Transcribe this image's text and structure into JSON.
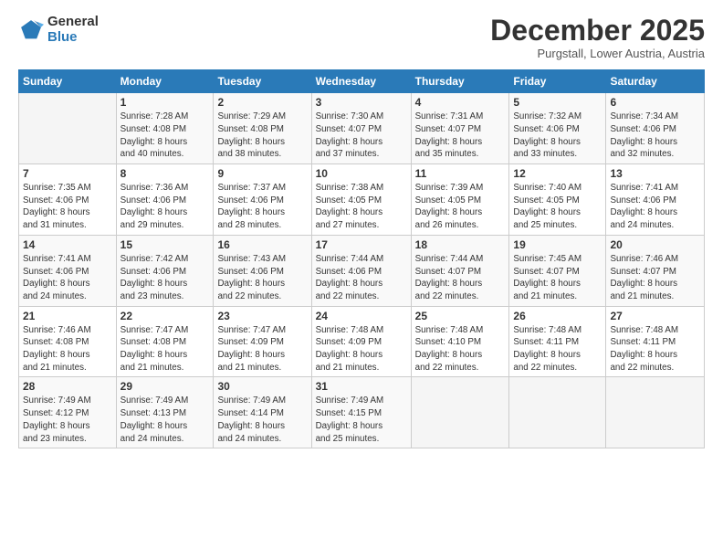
{
  "logo": {
    "general": "General",
    "blue": "Blue"
  },
  "header": {
    "month": "December 2025",
    "location": "Purgstall, Lower Austria, Austria"
  },
  "weekdays": [
    "Sunday",
    "Monday",
    "Tuesday",
    "Wednesday",
    "Thursday",
    "Friday",
    "Saturday"
  ],
  "weeks": [
    [
      {
        "day": "",
        "info": ""
      },
      {
        "day": "1",
        "info": "Sunrise: 7:28 AM\nSunset: 4:08 PM\nDaylight: 8 hours\nand 40 minutes."
      },
      {
        "day": "2",
        "info": "Sunrise: 7:29 AM\nSunset: 4:08 PM\nDaylight: 8 hours\nand 38 minutes."
      },
      {
        "day": "3",
        "info": "Sunrise: 7:30 AM\nSunset: 4:07 PM\nDaylight: 8 hours\nand 37 minutes."
      },
      {
        "day": "4",
        "info": "Sunrise: 7:31 AM\nSunset: 4:07 PM\nDaylight: 8 hours\nand 35 minutes."
      },
      {
        "day": "5",
        "info": "Sunrise: 7:32 AM\nSunset: 4:06 PM\nDaylight: 8 hours\nand 33 minutes."
      },
      {
        "day": "6",
        "info": "Sunrise: 7:34 AM\nSunset: 4:06 PM\nDaylight: 8 hours\nand 32 minutes."
      }
    ],
    [
      {
        "day": "7",
        "info": "Sunrise: 7:35 AM\nSunset: 4:06 PM\nDaylight: 8 hours\nand 31 minutes."
      },
      {
        "day": "8",
        "info": "Sunrise: 7:36 AM\nSunset: 4:06 PM\nDaylight: 8 hours\nand 29 minutes."
      },
      {
        "day": "9",
        "info": "Sunrise: 7:37 AM\nSunset: 4:06 PM\nDaylight: 8 hours\nand 28 minutes."
      },
      {
        "day": "10",
        "info": "Sunrise: 7:38 AM\nSunset: 4:05 PM\nDaylight: 8 hours\nand 27 minutes."
      },
      {
        "day": "11",
        "info": "Sunrise: 7:39 AM\nSunset: 4:05 PM\nDaylight: 8 hours\nand 26 minutes."
      },
      {
        "day": "12",
        "info": "Sunrise: 7:40 AM\nSunset: 4:05 PM\nDaylight: 8 hours\nand 25 minutes."
      },
      {
        "day": "13",
        "info": "Sunrise: 7:41 AM\nSunset: 4:06 PM\nDaylight: 8 hours\nand 24 minutes."
      }
    ],
    [
      {
        "day": "14",
        "info": "Sunrise: 7:41 AM\nSunset: 4:06 PM\nDaylight: 8 hours\nand 24 minutes."
      },
      {
        "day": "15",
        "info": "Sunrise: 7:42 AM\nSunset: 4:06 PM\nDaylight: 8 hours\nand 23 minutes."
      },
      {
        "day": "16",
        "info": "Sunrise: 7:43 AM\nSunset: 4:06 PM\nDaylight: 8 hours\nand 22 minutes."
      },
      {
        "day": "17",
        "info": "Sunrise: 7:44 AM\nSunset: 4:06 PM\nDaylight: 8 hours\nand 22 minutes."
      },
      {
        "day": "18",
        "info": "Sunrise: 7:44 AM\nSunset: 4:07 PM\nDaylight: 8 hours\nand 22 minutes."
      },
      {
        "day": "19",
        "info": "Sunrise: 7:45 AM\nSunset: 4:07 PM\nDaylight: 8 hours\nand 21 minutes."
      },
      {
        "day": "20",
        "info": "Sunrise: 7:46 AM\nSunset: 4:07 PM\nDaylight: 8 hours\nand 21 minutes."
      }
    ],
    [
      {
        "day": "21",
        "info": "Sunrise: 7:46 AM\nSunset: 4:08 PM\nDaylight: 8 hours\nand 21 minutes."
      },
      {
        "day": "22",
        "info": "Sunrise: 7:47 AM\nSunset: 4:08 PM\nDaylight: 8 hours\nand 21 minutes."
      },
      {
        "day": "23",
        "info": "Sunrise: 7:47 AM\nSunset: 4:09 PM\nDaylight: 8 hours\nand 21 minutes."
      },
      {
        "day": "24",
        "info": "Sunrise: 7:48 AM\nSunset: 4:09 PM\nDaylight: 8 hours\nand 21 minutes."
      },
      {
        "day": "25",
        "info": "Sunrise: 7:48 AM\nSunset: 4:10 PM\nDaylight: 8 hours\nand 22 minutes."
      },
      {
        "day": "26",
        "info": "Sunrise: 7:48 AM\nSunset: 4:11 PM\nDaylight: 8 hours\nand 22 minutes."
      },
      {
        "day": "27",
        "info": "Sunrise: 7:48 AM\nSunset: 4:11 PM\nDaylight: 8 hours\nand 22 minutes."
      }
    ],
    [
      {
        "day": "28",
        "info": "Sunrise: 7:49 AM\nSunset: 4:12 PM\nDaylight: 8 hours\nand 23 minutes."
      },
      {
        "day": "29",
        "info": "Sunrise: 7:49 AM\nSunset: 4:13 PM\nDaylight: 8 hours\nand 24 minutes."
      },
      {
        "day": "30",
        "info": "Sunrise: 7:49 AM\nSunset: 4:14 PM\nDaylight: 8 hours\nand 24 minutes."
      },
      {
        "day": "31",
        "info": "Sunrise: 7:49 AM\nSunset: 4:15 PM\nDaylight: 8 hours\nand 25 minutes."
      },
      {
        "day": "",
        "info": ""
      },
      {
        "day": "",
        "info": ""
      },
      {
        "day": "",
        "info": ""
      }
    ]
  ]
}
